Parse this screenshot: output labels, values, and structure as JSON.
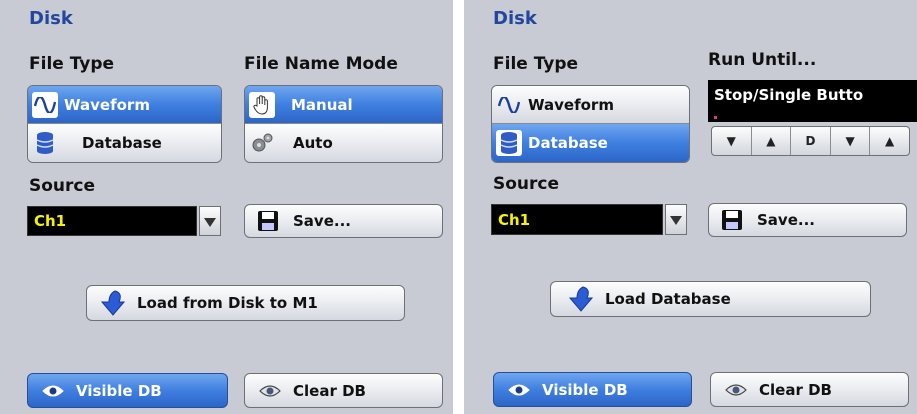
{
  "left": {
    "title": "Disk",
    "file_type_label": "File Type",
    "file_type_options": [
      "Waveform",
      "Database"
    ],
    "file_type_selected": "Waveform",
    "file_name_mode_label": "File Name Mode",
    "file_name_mode_options": [
      "Manual",
      "Auto"
    ],
    "file_name_mode_selected": "Manual",
    "source_label": "Source",
    "source_value": "Ch1",
    "save_label": "Save...",
    "load_label": "Load from Disk to M1",
    "visible_db_label": "Visible DB",
    "clear_db_label": "Clear DB"
  },
  "right": {
    "title": "Disk",
    "file_type_label": "File Type",
    "file_type_options": [
      "Waveform",
      "Database"
    ],
    "file_type_selected": "Database",
    "run_until_label": "Run Until...",
    "run_until_value": "Stop/Single Butto",
    "stepper_labels": [
      "▼",
      "▲",
      "D",
      "▼",
      "▲"
    ],
    "source_label": "Source",
    "source_value": "Ch1",
    "save_label": "Save...",
    "load_label": "Load Database",
    "visible_db_label": "Visible DB",
    "clear_db_label": "Clear DB"
  },
  "colors": {
    "panel_bg": "#c9cbd4",
    "title": "#23479d",
    "active_button": "#3f7fe0",
    "select_bg": "#000000",
    "select_text": "#f7f300"
  },
  "icons": {
    "waveform": "sine-wave-icon",
    "database": "database-icon",
    "manual": "hand-icon",
    "auto": "gears-icon",
    "save": "floppy-disk-icon",
    "load": "download-arrow-icon",
    "visible": "eye-icon",
    "clear": "eye-icon"
  }
}
